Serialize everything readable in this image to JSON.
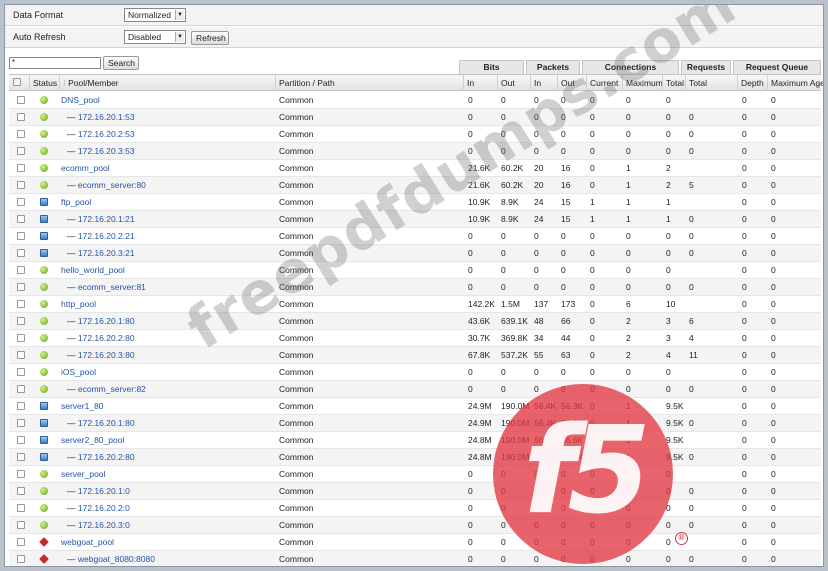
{
  "options": {
    "data_format_label": "Data Format",
    "data_format_value": "Normalized",
    "auto_refresh_label": "Auto Refresh",
    "auto_refresh_value": "Disabled",
    "refresh_button": "Refresh"
  },
  "search": {
    "value": "*",
    "button": "Search"
  },
  "groups": {
    "bits": "Bits",
    "packets": "Packets",
    "connections": "Connections",
    "requests": "Requests",
    "request_queue": "Request Queue"
  },
  "columns": {
    "status": "Status",
    "pool_member": "Pool/Member",
    "partition": "Partition / Path",
    "bits_in": "In",
    "bits_out": "Out",
    "pkts_in": "In",
    "pkts_out": "Out",
    "current": "Current",
    "maximum": "Maximum",
    "total": "Total",
    "req_total": "Total",
    "depth": "Depth",
    "max_age": "Maximum Age"
  },
  "rows": [
    {
      "status": "green",
      "member": false,
      "name": "DNS_pool",
      "partition": "Common",
      "bits_in": "0",
      "bits_out": "0",
      "pkts_in": "0",
      "pkts_out": "0",
      "current": "0",
      "maximum": "0",
      "total": "0",
      "req_total": "",
      "depth": "0",
      "max_age": "0"
    },
    {
      "status": "green",
      "member": true,
      "name": "172.16.20.1:53",
      "partition": "Common",
      "bits_in": "0",
      "bits_out": "0",
      "pkts_in": "0",
      "pkts_out": "0",
      "current": "0",
      "maximum": "0",
      "total": "0",
      "req_total": "0",
      "depth": "0",
      "max_age": "0"
    },
    {
      "status": "green",
      "member": true,
      "name": "172.16.20.2:53",
      "partition": "Common",
      "bits_in": "0",
      "bits_out": "0",
      "pkts_in": "0",
      "pkts_out": "0",
      "current": "0",
      "maximum": "0",
      "total": "0",
      "req_total": "0",
      "depth": "0",
      "max_age": "0"
    },
    {
      "status": "green",
      "member": true,
      "name": "172.16.20.3:53",
      "partition": "Common",
      "bits_in": "0",
      "bits_out": "0",
      "pkts_in": "0",
      "pkts_out": "0",
      "current": "0",
      "maximum": "0",
      "total": "0",
      "req_total": "0",
      "depth": "0",
      "max_age": "0"
    },
    {
      "status": "green",
      "member": false,
      "name": "ecomm_pool",
      "partition": "Common",
      "bits_in": "21.6K",
      "bits_out": "60.2K",
      "pkts_in": "20",
      "pkts_out": "16",
      "current": "0",
      "maximum": "1",
      "total": "2",
      "req_total": "",
      "depth": "0",
      "max_age": "0"
    },
    {
      "status": "green",
      "member": true,
      "name": "ecomm_server:80",
      "partition": "Common",
      "bits_in": "21.6K",
      "bits_out": "60.2K",
      "pkts_in": "20",
      "pkts_out": "16",
      "current": "0",
      "maximum": "1",
      "total": "2",
      "req_total": "5",
      "depth": "0",
      "max_age": "0"
    },
    {
      "status": "blue",
      "member": false,
      "name": "ftp_pool",
      "partition": "Common",
      "bits_in": "10.9K",
      "bits_out": "8.9K",
      "pkts_in": "24",
      "pkts_out": "15",
      "current": "1",
      "maximum": "1",
      "total": "1",
      "req_total": "",
      "depth": "0",
      "max_age": "0"
    },
    {
      "status": "blue",
      "member": true,
      "name": "172.16.20.1:21",
      "partition": "Common",
      "bits_in": "10.9K",
      "bits_out": "8.9K",
      "pkts_in": "24",
      "pkts_out": "15",
      "current": "1",
      "maximum": "1",
      "total": "1",
      "req_total": "0",
      "depth": "0",
      "max_age": "0"
    },
    {
      "status": "blue",
      "member": true,
      "name": "172.16.20.2:21",
      "partition": "Common",
      "bits_in": "0",
      "bits_out": "0",
      "pkts_in": "0",
      "pkts_out": "0",
      "current": "0",
      "maximum": "0",
      "total": "0",
      "req_total": "0",
      "depth": "0",
      "max_age": "0"
    },
    {
      "status": "blue",
      "member": true,
      "name": "172.16.20.3:21",
      "partition": "Common",
      "bits_in": "0",
      "bits_out": "0",
      "pkts_in": "0",
      "pkts_out": "0",
      "current": "0",
      "maximum": "0",
      "total": "0",
      "req_total": "0",
      "depth": "0",
      "max_age": "0"
    },
    {
      "status": "green",
      "member": false,
      "name": "hello_world_pool",
      "partition": "Common",
      "bits_in": "0",
      "bits_out": "0",
      "pkts_in": "0",
      "pkts_out": "0",
      "current": "0",
      "maximum": "0",
      "total": "0",
      "req_total": "",
      "depth": "0",
      "max_age": "0"
    },
    {
      "status": "green",
      "member": true,
      "name": "ecomm_server:81",
      "partition": "Common",
      "bits_in": "0",
      "bits_out": "0",
      "pkts_in": "0",
      "pkts_out": "0",
      "current": "0",
      "maximum": "0",
      "total": "0",
      "req_total": "0",
      "depth": "0",
      "max_age": "0"
    },
    {
      "status": "green",
      "member": false,
      "name": "http_pool",
      "partition": "Common",
      "bits_in": "142.2K",
      "bits_out": "1.5M",
      "pkts_in": "137",
      "pkts_out": "173",
      "current": "0",
      "maximum": "6",
      "total": "10",
      "req_total": "",
      "depth": "0",
      "max_age": "0"
    },
    {
      "status": "green",
      "member": true,
      "name": "172.16.20.1:80",
      "partition": "Common",
      "bits_in": "43.6K",
      "bits_out": "639.1K",
      "pkts_in": "48",
      "pkts_out": "66",
      "current": "0",
      "maximum": "2",
      "total": "3",
      "req_total": "6",
      "depth": "0",
      "max_age": "0"
    },
    {
      "status": "green",
      "member": true,
      "name": "172.16.20.2:80",
      "partition": "Common",
      "bits_in": "30.7K",
      "bits_out": "369.8K",
      "pkts_in": "34",
      "pkts_out": "44",
      "current": "0",
      "maximum": "2",
      "total": "3",
      "req_total": "4",
      "depth": "0",
      "max_age": "0"
    },
    {
      "status": "green",
      "member": true,
      "name": "172.16.20.3:80",
      "partition": "Common",
      "bits_in": "67.8K",
      "bits_out": "537.2K",
      "pkts_in": "55",
      "pkts_out": "63",
      "current": "0",
      "maximum": "2",
      "total": "4",
      "req_total": "11",
      "depth": "0",
      "max_age": "0"
    },
    {
      "status": "green",
      "member": false,
      "name": "iOS_pool",
      "partition": "Common",
      "bits_in": "0",
      "bits_out": "0",
      "pkts_in": "0",
      "pkts_out": "0",
      "current": "0",
      "maximum": "0",
      "total": "0",
      "req_total": "",
      "depth": "0",
      "max_age": "0"
    },
    {
      "status": "green",
      "member": true,
      "name": "ecomm_server:82",
      "partition": "Common",
      "bits_in": "0",
      "bits_out": "0",
      "pkts_in": "0",
      "pkts_out": "0",
      "current": "0",
      "maximum": "0",
      "total": "0",
      "req_total": "0",
      "depth": "0",
      "max_age": "0"
    },
    {
      "status": "blue",
      "member": false,
      "name": "server1_80",
      "partition": "Common",
      "bits_in": "24.9M",
      "bits_out": "190.0M",
      "pkts_in": "56.4K",
      "pkts_out": "56.3K",
      "current": "0",
      "maximum": "1",
      "total": "9.5K",
      "req_total": "",
      "depth": "0",
      "max_age": "0"
    },
    {
      "status": "blue",
      "member": true,
      "name": "172.16.20.1:80",
      "partition": "Common",
      "bits_in": "24.9M",
      "bits_out": "190.0M",
      "pkts_in": "56.4K",
      "pkts_out": "56.3K",
      "current": "0",
      "maximum": "1",
      "total": "9.5K",
      "req_total": "0",
      "depth": "0",
      "max_age": "0"
    },
    {
      "status": "blue",
      "member": false,
      "name": "server2_80_pool",
      "partition": "Common",
      "bits_in": "24.8M",
      "bits_out": "190.0M",
      "pkts_in": "56.3K",
      "pkts_out": "56.6K",
      "current": "0",
      "maximum": "1",
      "total": "9.5K",
      "req_total": "",
      "depth": "0",
      "max_age": "0"
    },
    {
      "status": "blue",
      "member": true,
      "name": "172.16.20.2:80",
      "partition": "Common",
      "bits_in": "24.8M",
      "bits_out": "190.0M",
      "pkts_in": "56.3K",
      "pkts_out": "56.6K",
      "current": "0",
      "maximum": "1",
      "total": "9.5K",
      "req_total": "0",
      "depth": "0",
      "max_age": "0"
    },
    {
      "status": "green",
      "member": false,
      "name": "server_pool",
      "partition": "Common",
      "bits_in": "0",
      "bits_out": "0",
      "pkts_in": "0",
      "pkts_out": "0",
      "current": "0",
      "maximum": "0",
      "total": "0",
      "req_total": "",
      "depth": "0",
      "max_age": "0"
    },
    {
      "status": "green",
      "member": true,
      "name": "172.16.20.1:0",
      "partition": "Common",
      "bits_in": "0",
      "bits_out": "0",
      "pkts_in": "0",
      "pkts_out": "0",
      "current": "0",
      "maximum": "0",
      "total": "0",
      "req_total": "0",
      "depth": "0",
      "max_age": "0"
    },
    {
      "status": "green",
      "member": true,
      "name": "172.16.20.2:0",
      "partition": "Common",
      "bits_in": "0",
      "bits_out": "0",
      "pkts_in": "0",
      "pkts_out": "0",
      "current": "0",
      "maximum": "0",
      "total": "0",
      "req_total": "0",
      "depth": "0",
      "max_age": "0"
    },
    {
      "status": "green",
      "member": true,
      "name": "172.16.20.3:0",
      "partition": "Common",
      "bits_in": "0",
      "bits_out": "0",
      "pkts_in": "0",
      "pkts_out": "0",
      "current": "0",
      "maximum": "0",
      "total": "0",
      "req_total": "0",
      "depth": "0",
      "max_age": "0"
    },
    {
      "status": "red",
      "member": false,
      "name": "webgoat_pool",
      "partition": "Common",
      "bits_in": "0",
      "bits_out": "0",
      "pkts_in": "0",
      "pkts_out": "0",
      "current": "0",
      "maximum": "0",
      "total": "0",
      "req_total": "",
      "depth": "0",
      "max_age": "0"
    },
    {
      "status": "red",
      "member": true,
      "name": "webgoat_8080:8080",
      "partition": "Common",
      "bits_in": "0",
      "bits_out": "0",
      "pkts_in": "0",
      "pkts_out": "0",
      "current": "0",
      "maximum": "0",
      "total": "0",
      "req_total": "0",
      "depth": "0",
      "max_age": "0"
    }
  ],
  "watermark": "freepdfdumps.com",
  "logo": {
    "text": "f5",
    "registered": "®"
  }
}
